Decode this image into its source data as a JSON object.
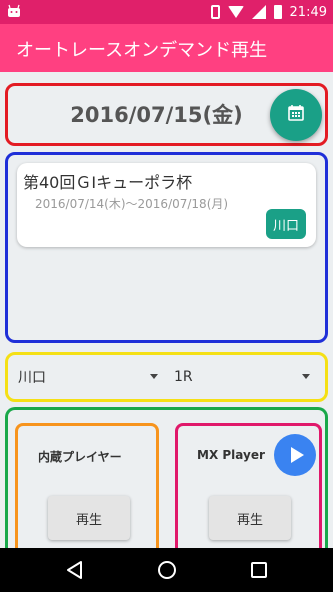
{
  "status_bar": {
    "time": "21:49",
    "icons": [
      "android-icon",
      "vibrate-icon",
      "wifi-icon",
      "signal-icon",
      "battery-icon"
    ]
  },
  "app_bar": {
    "title": "オートレースオンデマンド再生",
    "color": "#ff4081"
  },
  "date_section": {
    "date": "2016/07/15(金)",
    "calendar_button_icon": "calendar-icon",
    "accent": "#1aa087"
  },
  "race_card": {
    "title": "第40回ＧⅠキューポラ杯",
    "dates": "2016/07/14(木)〜2016/07/18(月)",
    "venue_badge": "川口"
  },
  "selectors": {
    "venue": "川口",
    "race": "1R"
  },
  "players": {
    "internal": {
      "label": "内蔵プレイヤー",
      "play_label": "再生"
    },
    "mx": {
      "label": "MX Player",
      "play_label": "再生",
      "icon": "play-icon"
    }
  },
  "nav_bar": {
    "icons": [
      "back-icon",
      "home-icon",
      "recents-icon"
    ]
  }
}
